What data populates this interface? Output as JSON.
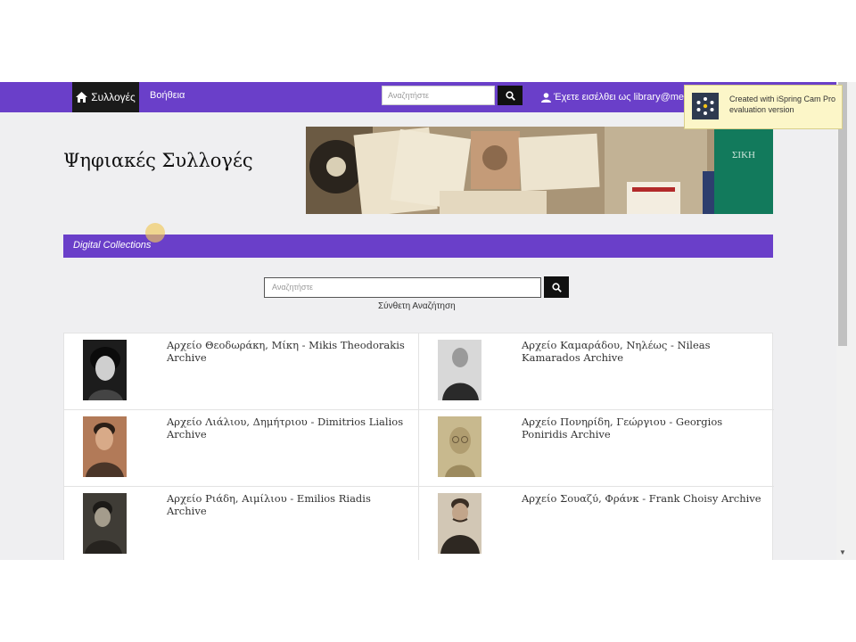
{
  "theme": {
    "accent": "#6a3fc9",
    "dark": "#111111"
  },
  "navbar": {
    "home_label": "Συλλογές",
    "help_label": "Βοήθεια",
    "search_placeholder": "Αναζητήστε",
    "user_text": "Έχετε εισέλθει ως library@mega"
  },
  "overlay": {
    "line1": "Created with iSpring Cam Pro",
    "line2": "evaluation version"
  },
  "header": {
    "title": "Ψηφιακές Συλλογές"
  },
  "section": {
    "label": "Digital Collections"
  },
  "search": {
    "placeholder": "Αναζητήστε",
    "advanced_label": "Σύνθετη Αναζήτηση"
  },
  "collections": [
    {
      "title": "Αρχείο Θεοδωράκη, Μίκη - Mikis Theodorakis Archive"
    },
    {
      "title": "Αρχείο Καμαράδου, Νηλέως - Nileas Kamarados Archive"
    },
    {
      "title": "Αρχείο Λιάλιου, Δημήτριου - Dimitrios Lialios Archive"
    },
    {
      "title": "Αρχείο Πονηρίδη, Γεώργιου - Georgios Poniridis Archive"
    },
    {
      "title": "Αρχείο Ριάδη, Αιμίλιου - Emilios Riadis Archive"
    },
    {
      "title": "Αρχείο Σουαζύ, Φράνκ - Frank Choisy Archive"
    }
  ]
}
